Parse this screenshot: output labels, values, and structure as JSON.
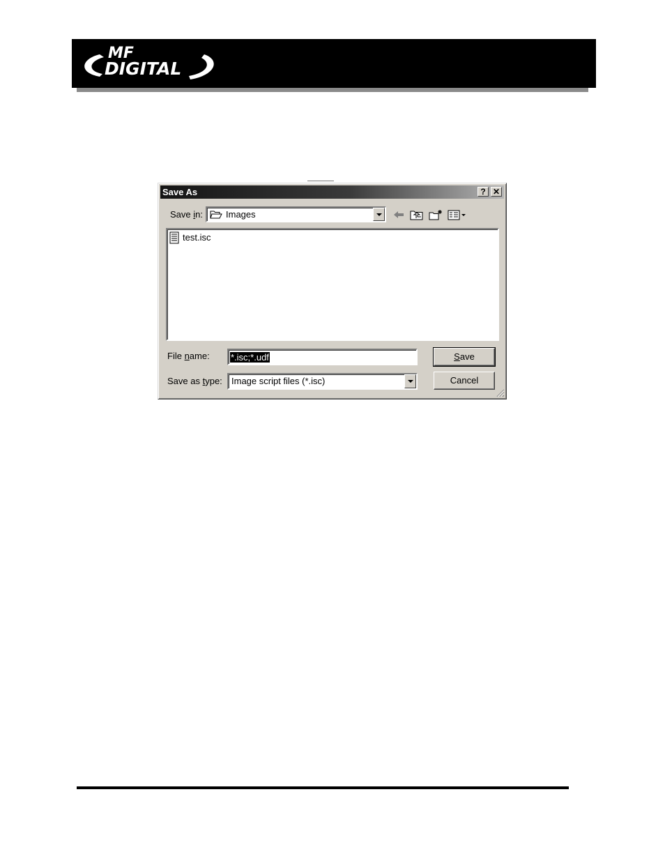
{
  "dialog": {
    "title": "Save As",
    "help_button": "?",
    "close_button": "✕",
    "save_in": {
      "label_before": "Save ",
      "label_mnemonic": "i",
      "label_after": "n:",
      "value": "Images"
    },
    "files": [
      {
        "name": "test.isc"
      }
    ],
    "file_name": {
      "label_before": "File ",
      "label_mnemonic": "n",
      "label_after": "ame:",
      "value": "*.isc;*.udf"
    },
    "save_as_type": {
      "label_before": "Save as ",
      "label_mnemonic": "t",
      "label_after": "ype:",
      "value": "Image script files (*.isc)"
    },
    "save_button": {
      "mnemonic": "S",
      "rest": "ave"
    },
    "cancel_button": "Cancel"
  },
  "brand": {
    "line1": "MF",
    "line2": "DIGITAL"
  }
}
